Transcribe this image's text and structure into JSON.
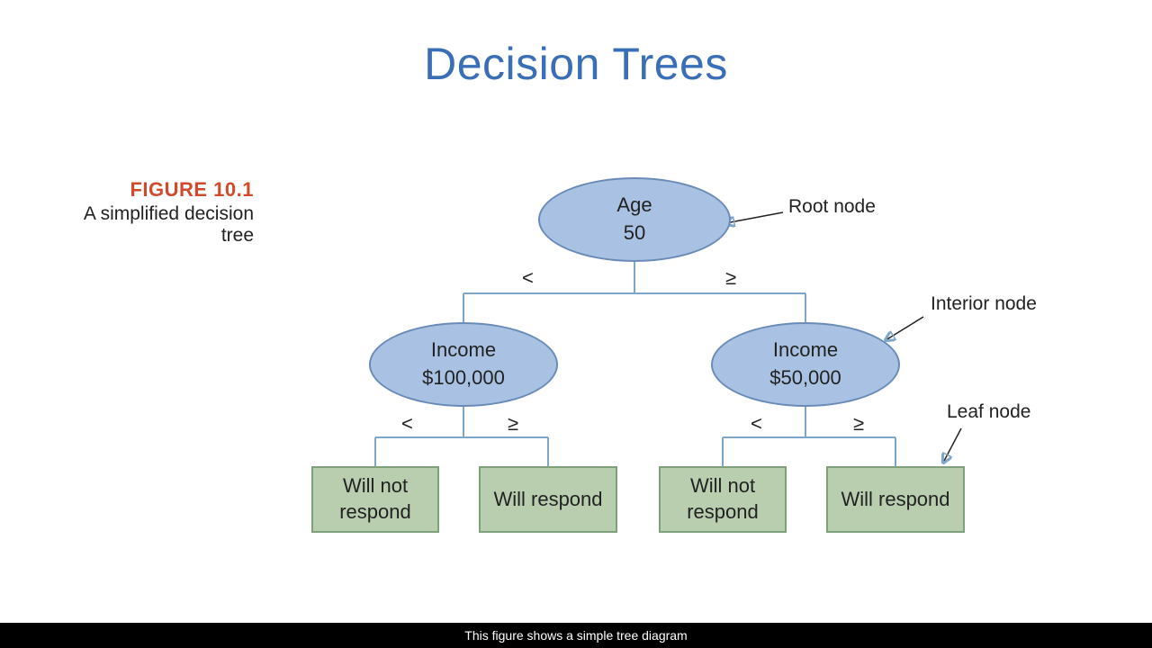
{
  "title": "Decision Trees",
  "figure": {
    "number": "FIGURE 10.1",
    "caption": "A simplified decision tree"
  },
  "annotations": {
    "root": "Root node",
    "interior": "Interior node",
    "leaf": "Leaf node"
  },
  "ops": {
    "lt": "<",
    "ge": "≥"
  },
  "nodes": {
    "root": {
      "line1": "Age",
      "line2": "50"
    },
    "left": {
      "line1": "Income",
      "line2": "$100,000"
    },
    "right": {
      "line1": "Income",
      "line2": "$50,000"
    }
  },
  "leaves": {
    "l1": {
      "line1": "Will not",
      "line2": "respond"
    },
    "l2": {
      "line1": "Will respond"
    },
    "l3": {
      "line1": "Will not",
      "line2": "respond"
    },
    "l4": {
      "line1": "Will respond"
    }
  },
  "footer": "This figure shows a simple tree diagram"
}
